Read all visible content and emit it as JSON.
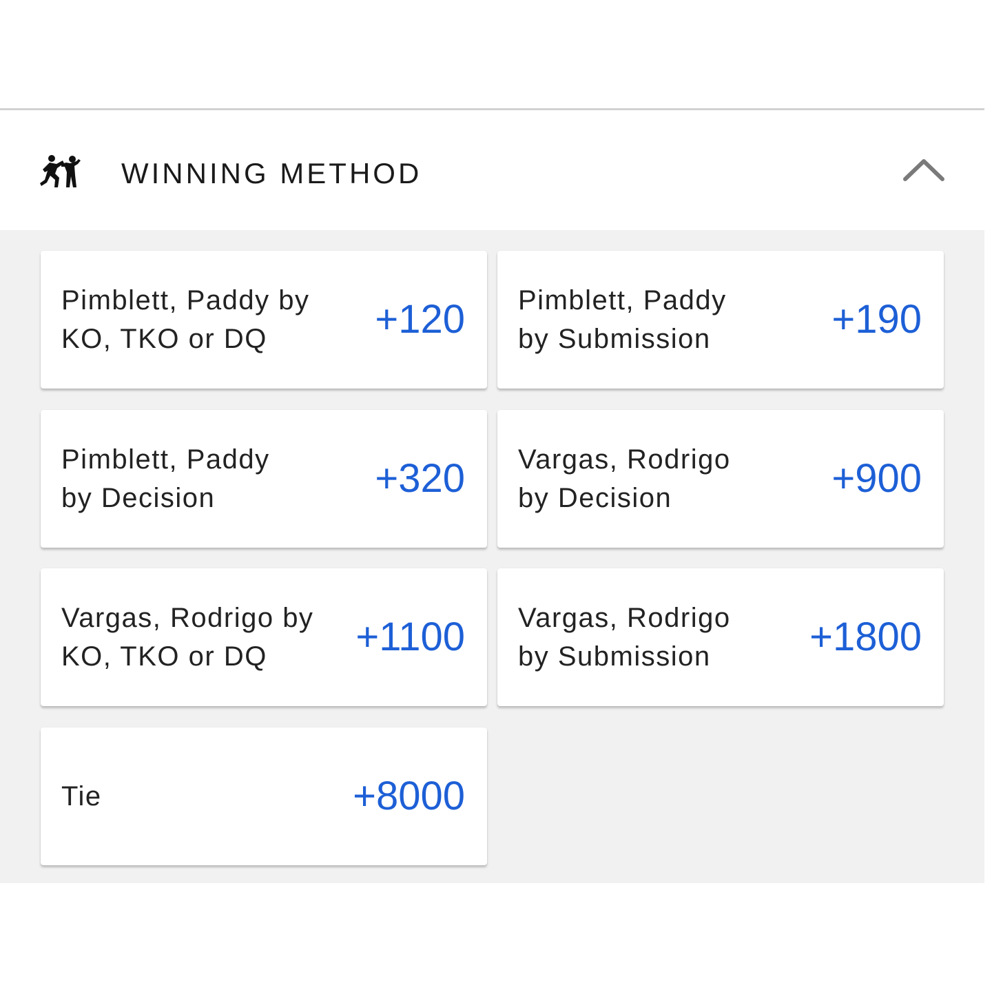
{
  "market": {
    "title": "WINNING METHOD",
    "icon": "fighters-icon",
    "toggle_icon": "chevron-up-icon",
    "accent_color": "#1d5fd6"
  },
  "selections": [
    {
      "label_line1": "Pimblett, Paddy by",
      "label_line2": "KO, TKO or DQ",
      "odds": "+120"
    },
    {
      "label_line1": "Pimblett, Paddy",
      "label_line2": "by Submission",
      "odds": "+190"
    },
    {
      "label_line1": "Pimblett, Paddy",
      "label_line2": "by Decision",
      "odds": "+320"
    },
    {
      "label_line1": "Vargas, Rodrigo",
      "label_line2": "by Decision",
      "odds": "+900"
    },
    {
      "label_line1": "Vargas, Rodrigo by",
      "label_line2": "KO, TKO or DQ",
      "odds": "+1100"
    },
    {
      "label_line1": "Vargas, Rodrigo",
      "label_line2": "by Submission",
      "odds": "+1800"
    },
    {
      "label_line1": "Tie",
      "label_line2": "",
      "odds": "+8000"
    }
  ]
}
